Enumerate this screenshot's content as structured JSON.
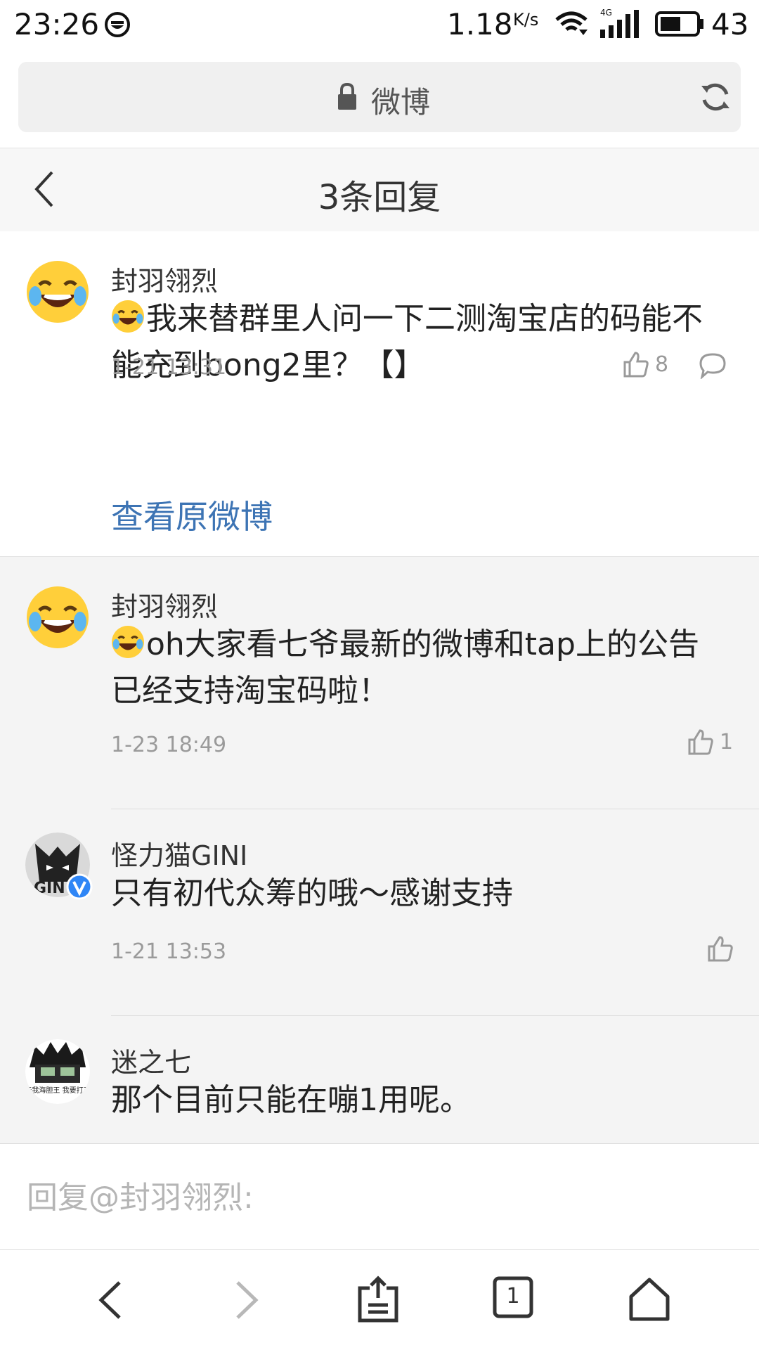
{
  "status_bar": {
    "time": "23:26",
    "net_speed": "1.18",
    "net_speed_unit": "K/s",
    "network_type": "4G",
    "battery": "43"
  },
  "url_bar": {
    "title": "微博"
  },
  "header": {
    "title": "3条回复"
  },
  "main_comment": {
    "username": "封羽翎烈",
    "text": "我来替群里人问一下二测淘宝店的码能不能充到bong2里？【】",
    "time": "1-21 13:31",
    "likes": "8",
    "view_original": "查看原微博"
  },
  "replies": [
    {
      "username": "封羽翎烈",
      "text": "oh大家看七爷最新的微博和tap上的公告 已经支持淘宝码啦！",
      "time": "1-23 18:49",
      "likes": "1"
    },
    {
      "username": "怪力猫GINI",
      "text": "只有初代众筹的哦～感谢支持",
      "time": "1-21 13:53",
      "likes": ""
    },
    {
      "username": "迷之七",
      "text": "那个目前只能在嘣1用呢。",
      "avatar_caption": "今天我海胆王 我要打五个"
    }
  ],
  "reply_input": {
    "placeholder": "回复@封羽翎烈:"
  },
  "bottom_nav": {
    "tab_count": "1"
  },
  "colors": {
    "link": "#3d74b4",
    "verified": "#2f86f6"
  }
}
